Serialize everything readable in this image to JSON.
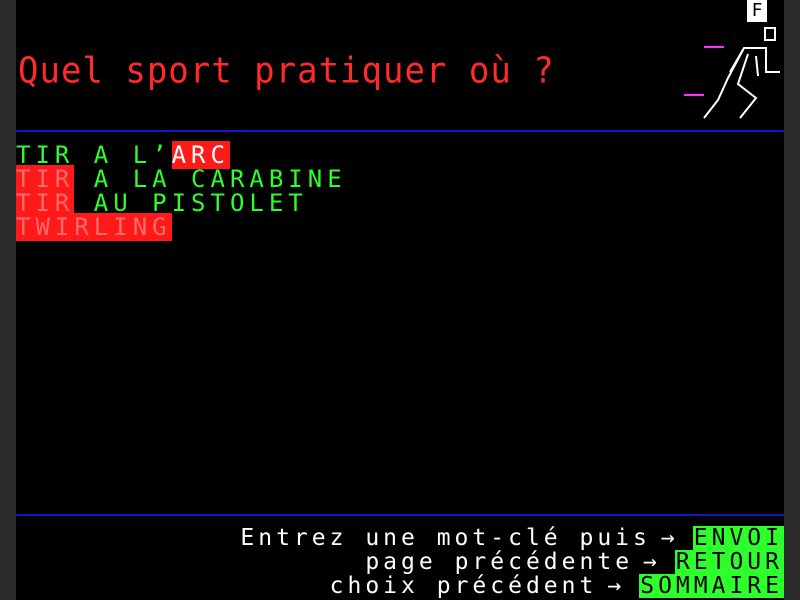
{
  "page": {
    "title": "Quel sport pratiquer où ?",
    "corner_label": "F"
  },
  "results": [
    {
      "segments": [
        {
          "text": "TIR A L’",
          "style": "normal"
        },
        {
          "text": "ARC",
          "style": "highlight-bright"
        }
      ]
    },
    {
      "segments": [
        {
          "text": "TIR",
          "style": "highlight"
        },
        {
          "text": " A LA CARABINE",
          "style": "normal"
        }
      ]
    },
    {
      "segments": [
        {
          "text": "TIR",
          "style": "highlight"
        },
        {
          "text": " AU PISTOLET",
          "style": "normal"
        }
      ]
    },
    {
      "segments": [
        {
          "text": "TWIRLING",
          "style": "highlight"
        }
      ]
    }
  ],
  "footer": [
    {
      "text": "Entrez une mot-clé puis",
      "arrow": "→",
      "key": "ENVOI"
    },
    {
      "text": "page précédente",
      "arrow": "→",
      "key": "RETOUR"
    },
    {
      "text": "choix précédent",
      "arrow": "→",
      "key": "SOMMAIRE"
    }
  ],
  "colors": {
    "background": "#000000",
    "title": "#ff2a2a",
    "result_text": "#2cff2c",
    "highlight_bg": "#ff1a1a",
    "rule": "#1414c8",
    "key_bg": "#2cff2c"
  },
  "icons": {
    "figure": "running-person-icon"
  }
}
